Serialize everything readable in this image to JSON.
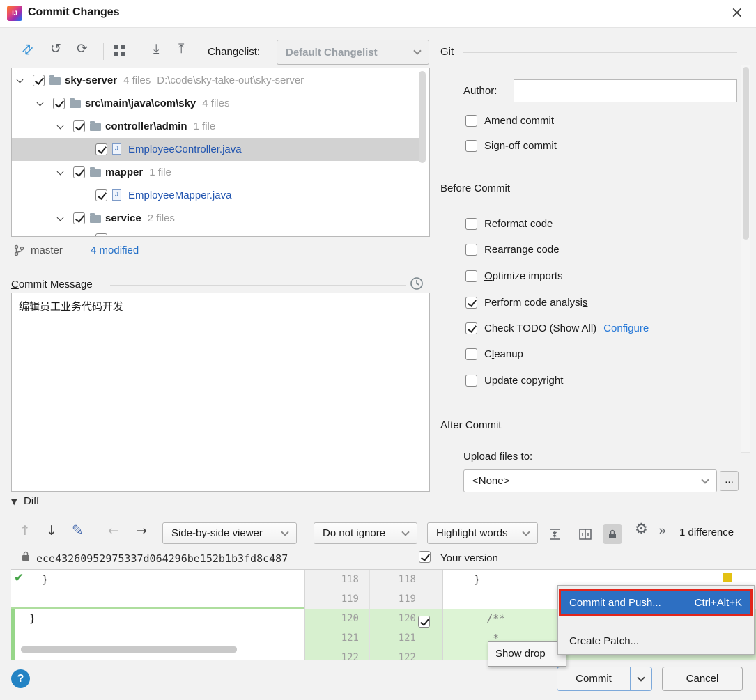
{
  "window": {
    "title": "Commit Changes"
  },
  "icons": {
    "app": "IJ",
    "close": "×",
    "show_diff": "⇄",
    "undo": "↺",
    "refresh": "⟳",
    "expand_all": "⤓",
    "collapse_all": "⤒",
    "prev_difference": "↑",
    "next_difference": "↓",
    "edit_source": "✎",
    "back": "←",
    "forward": "→",
    "gear": "⚙",
    "more": "»",
    "applied_check": "✔",
    "collapse_triangle": "▼",
    "help": "?"
  },
  "toolbar": {
    "changelist_label": "Changelist:",
    "changelist_value": "Default Changelist"
  },
  "tree": {
    "rows": [
      {
        "label": "sky-server",
        "count": "4 files",
        "path": "D:\\code\\sky-take-out\\sky-server",
        "checked": true
      },
      {
        "label": "src\\main\\java\\com\\sky",
        "count": "4 files",
        "checked": true
      },
      {
        "label": "controller\\admin",
        "count": "1 file",
        "checked": true
      },
      {
        "label": "EmployeeController.java",
        "checked": true
      },
      {
        "label": "mapper",
        "count": "1 file",
        "checked": true
      },
      {
        "label": "EmployeeMapper.java",
        "checked": true
      },
      {
        "label": "service",
        "count": "2 files",
        "checked": true
      },
      {
        "checked": true
      }
    ]
  },
  "branch": {
    "name": "master",
    "modified_link": "4 modified"
  },
  "commit_message": {
    "label": "Commit Message",
    "text": "编辑员工业务代码开发"
  },
  "git_panel": {
    "section": "Git",
    "author_label": "Author:",
    "author_value": "",
    "amend_label": "Amend commit",
    "amend_checked": false,
    "signoff_label": "Sign-off commit",
    "signoff_checked": false
  },
  "before_commit": {
    "section": "Before Commit",
    "options": [
      {
        "label": "Reformat code",
        "checked": false
      },
      {
        "label": "Rearrange code",
        "checked": false
      },
      {
        "label": "Optimize imports",
        "checked": false
      },
      {
        "label": "Perform code analysis",
        "checked": true
      },
      {
        "label": "Check TODO (Show All)",
        "checked": true,
        "link": "Configure"
      },
      {
        "label": "Cleanup",
        "checked": false
      },
      {
        "label": "Update copyright",
        "checked": false
      }
    ]
  },
  "after_commit": {
    "section": "After Commit",
    "upload_label": "Upload files to:",
    "upload_value": "<None>",
    "browse_label": "..."
  },
  "diff": {
    "section": "Diff",
    "viewer_mode": "Side-by-side viewer",
    "ignore_mode": "Do not ignore",
    "highlight_mode": "Highlight words",
    "difference_count": "1 difference",
    "revision_hash": "ece43260952975337d064296be152b1b3fd8c487",
    "your_version_label": "Your version",
    "your_version_checked": true,
    "change_checkbox_checked": true,
    "left_lines": [
      {
        "num": "118",
        "code": "    }"
      },
      {
        "num": "119",
        "code": ""
      },
      {
        "num": "120",
        "code": "  }"
      },
      {
        "num": "121",
        "code": ""
      },
      {
        "num": "122",
        "code": ""
      }
    ],
    "right_lines": [
      {
        "num": "118",
        "code": "    }"
      },
      {
        "num": "119",
        "code": ""
      },
      {
        "num": "120",
        "code": "      /**"
      },
      {
        "num": "121",
        "code": "       *"
      },
      {
        "num": "122",
        "code": ""
      }
    ]
  },
  "popup_menu": {
    "items": [
      {
        "label": "Commit and Push...",
        "shortcut": "Ctrl+Alt+K"
      },
      {
        "label": "Create Patch..."
      }
    ]
  },
  "tooltip": {
    "text": "Show drop"
  },
  "footer": {
    "commit_label": "Commit",
    "cancel_label": "Cancel"
  },
  "colors": {
    "selection_blue": "#2d6fc2",
    "annotation_red": "#e1261c",
    "file_blue": "#2356b0",
    "link_blue": "#2779d8",
    "diff_green_row": "#ddf4d5",
    "diff_green_gutter": "#d7f0cf",
    "marker_yellow": "#e3c113"
  }
}
